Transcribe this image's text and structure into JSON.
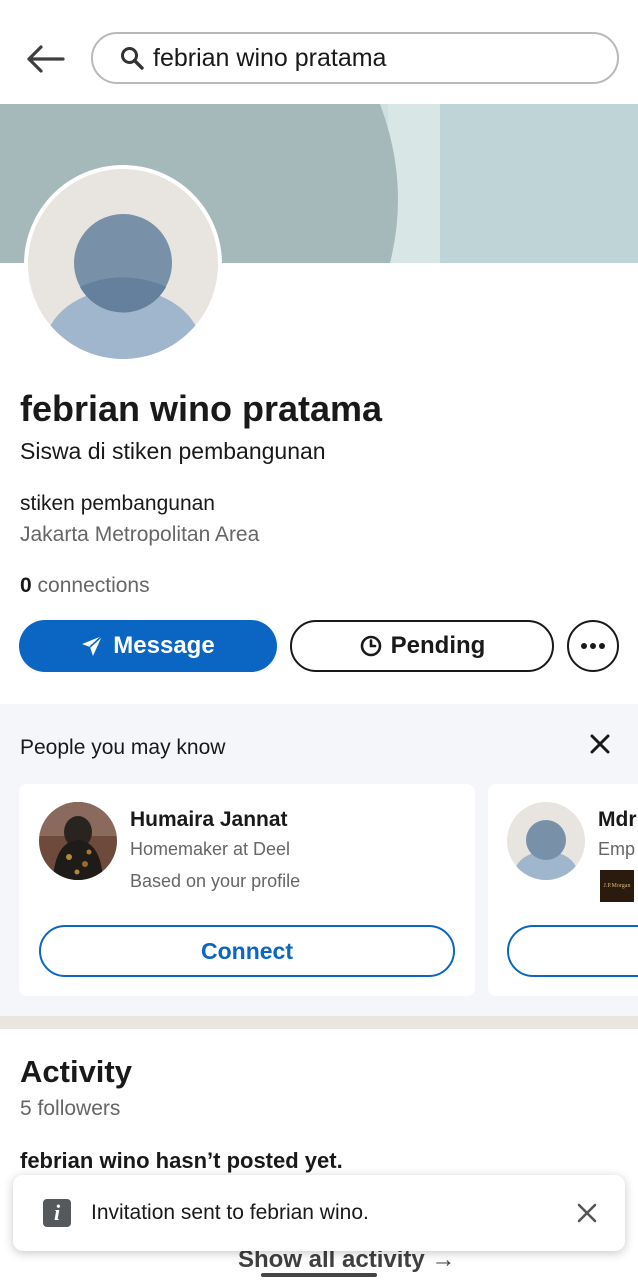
{
  "search": {
    "query": "febrian wino pratama"
  },
  "profile": {
    "name": "febrian wino pratama",
    "headline": "Siswa di stiken pembangunan",
    "organization": "stiken pembangunan",
    "location": "Jakarta Metropolitan Area",
    "connections_count": "0",
    "connections_label": "connections"
  },
  "actions": {
    "message_label": "Message",
    "pending_label": "Pending"
  },
  "pymk": {
    "title": "People you may know",
    "cards": [
      {
        "name": "Humaira Jannat",
        "subtitle": "Homemaker at Deel",
        "reason": "Based on your profile",
        "connect_label": "Connect"
      },
      {
        "name": "Mdr",
        "subtitle": "Emp",
        "company_logo_text": "J.P.Morgan",
        "connect_label": ""
      }
    ]
  },
  "activity": {
    "title": "Activity",
    "followers": "5 followers",
    "empty_message": "febrian wino hasn’t posted yet.",
    "show_all_label": "Show all activity →"
  },
  "toast": {
    "message": "Invitation sent to febrian wino.",
    "icon_glyph": "i"
  },
  "colors": {
    "primary": "#0a66c2",
    "banner_light": "#cfe0e0",
    "banner_dark": "#a6b9ba",
    "avatar_bg": "#e8e5e0",
    "avatar_head": "#7890a8",
    "avatar_body": "#a0b6cc",
    "section_bg": "#f4f6f9"
  }
}
